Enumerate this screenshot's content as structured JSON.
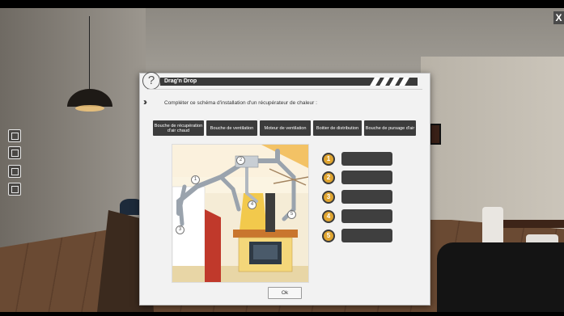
{
  "window": {
    "close_label": "X"
  },
  "toolbar": {
    "tools": [
      "plan-tool",
      "room-tool",
      "gallery-tool",
      "object-tool"
    ]
  },
  "dialog": {
    "help_symbol": "?",
    "title": "Drag'n Drop",
    "instruction": "Compléter ce schéma d'installation d'un récupérateur de chaleur :",
    "labels": [
      "Bouche de récupération d'air chaud",
      "Bouche de ventilation",
      "Moteur de ventilation",
      "Boitier de distribution",
      "Bouche de pursage d'air"
    ],
    "diagram_markers": [
      "1",
      "2",
      "3",
      "4",
      "5"
    ],
    "slots": [
      {
        "number": "1",
        "value": ""
      },
      {
        "number": "2",
        "value": ""
      },
      {
        "number": "3",
        "value": ""
      },
      {
        "number": "4",
        "value": ""
      },
      {
        "number": "5",
        "value": ""
      }
    ],
    "ok_label": "Ok"
  },
  "colors": {
    "title_bar": "#3a3a3a",
    "label_button": "#3c3c3c",
    "slot": "#3f3f3f",
    "slot_number": "#e0a530",
    "dialog_bg": "#f2f2f2"
  }
}
